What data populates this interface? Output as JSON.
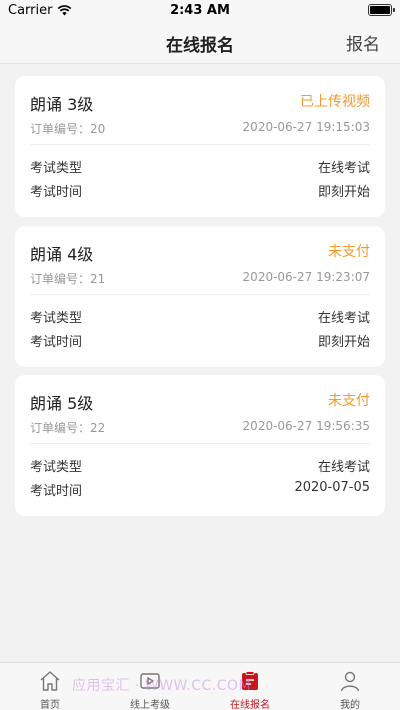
{
  "status_bar": {
    "carrier": "Carrier",
    "time": "2:43 AM"
  },
  "nav": {
    "title": "在线报名",
    "action": "报名"
  },
  "orders": [
    {
      "level": "朗诵 3级",
      "status": "已上传视频",
      "order_no": "订单编号：20",
      "datetime": "2020-06-27 19:15:03",
      "type_label": "考试类型",
      "type_value": "在线考试",
      "time_label": "考试时间",
      "time_value": "即刻开始"
    },
    {
      "level": "朗诵 4级",
      "status": "未支付",
      "order_no": "订单编号：21",
      "datetime": "2020-06-27 19:23:07",
      "type_label": "考试类型",
      "type_value": "在线考试",
      "time_label": "考试时间",
      "time_value": "即刻开始"
    },
    {
      "level": "朗诵 5级",
      "status": "未支付",
      "order_no": "订单编号：22",
      "datetime": "2020-06-27 19:56:35",
      "type_label": "考试类型",
      "type_value": "在线考试",
      "time_label": "考试时间",
      "time_value": "2020-07-05"
    }
  ],
  "tabs": [
    {
      "label": "首页",
      "icon": "home-icon"
    },
    {
      "label": "线上考级",
      "icon": "video-icon"
    },
    {
      "label": "在线报名",
      "icon": "signup-icon",
      "active": true
    },
    {
      "label": "我的",
      "icon": "person-icon"
    }
  ],
  "watermark": "应用宝汇 · WWW.CC.COM",
  "colors": {
    "accent_status": "#f29a2e",
    "active_tab": "#c8161d"
  }
}
